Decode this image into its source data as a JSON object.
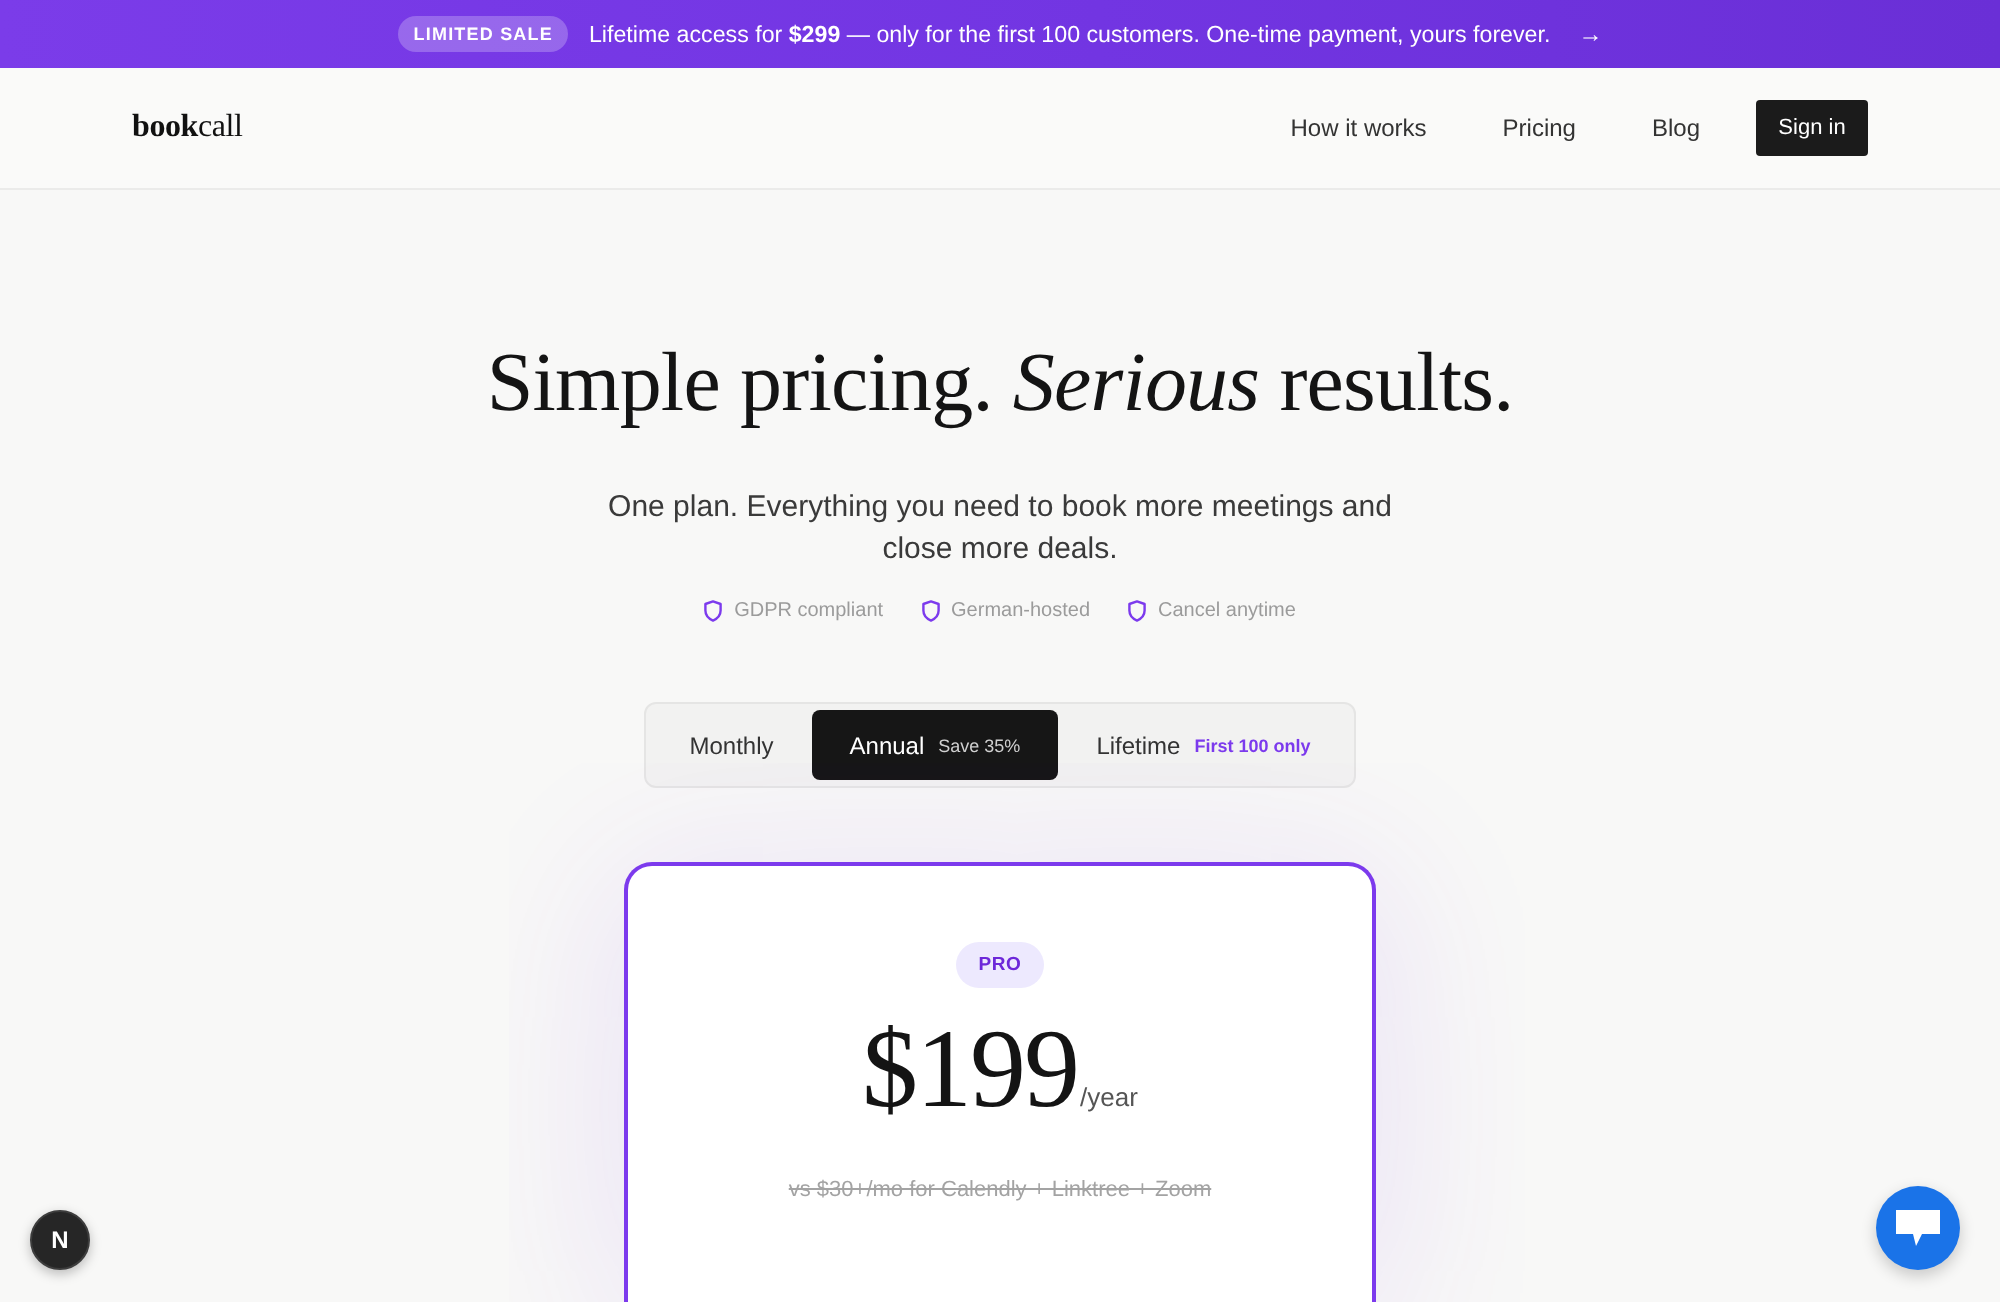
{
  "banner": {
    "badge": "LIMITED SALE",
    "message": "Lifetime access for **$299** — only for the first 100 customers. One-time payment, yours forever.",
    "arrow": "→"
  },
  "header": {
    "logo": "**book**call",
    "nav": [
      "How it works",
      "Pricing",
      "Blog"
    ],
    "cta": "Sign in"
  },
  "hero": {
    "title": "Simple pricing. *Serious* results.",
    "subtitle": "One plan. Everything you need to book more meetings and close more deals.",
    "trust_badges": [
      "GDPR compliant",
      "German-hosted",
      "Cancel anytime"
    ]
  },
  "billing_toggle": [
    {
      "label": "Monthly",
      "selected": false
    },
    {
      "label": "Annual",
      "note": "Save 35%",
      "selected": true
    },
    {
      "label": "Lifetime",
      "note": "First 100 only",
      "selected": false
    }
  ],
  "plan_card": {
    "badge": "PRO",
    "price": "$199",
    "period": "/year",
    "comparison": "vs $30+/mo for Calendly + Linktree + Zoom"
  },
  "dev_indicator": {
    "label": "N"
  }
}
